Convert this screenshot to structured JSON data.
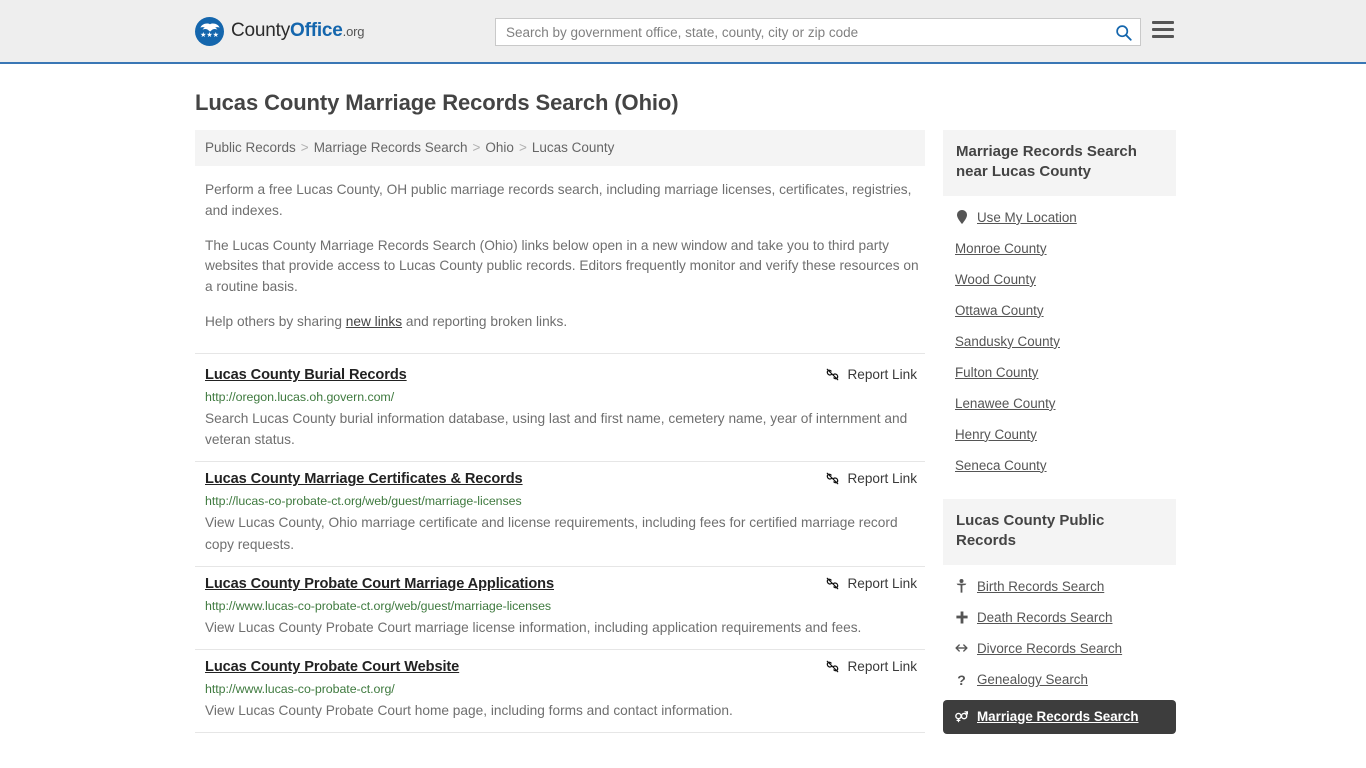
{
  "header": {
    "logo_text_1": "County",
    "logo_text_2": "Office",
    "logo_text_3": ".org",
    "logo_stars": "★★★",
    "search_placeholder": "Search by government office, state, county, city or zip code",
    "search_value": "",
    "search_icon": "search-icon",
    "menu_icon": "hamburger-menu-icon"
  },
  "page": {
    "title": "Lucas County Marriage Records Search (Ohio)"
  },
  "breadcrumb": {
    "items": [
      {
        "label": "Public Records"
      },
      {
        "label": "Marriage Records Search"
      },
      {
        "label": "Ohio"
      },
      {
        "label": "Lucas County"
      }
    ],
    "separator": ">"
  },
  "intro": {
    "p1": "Perform a free Lucas County, OH public marriage records search, including marriage licenses, certificates, registries, and indexes.",
    "p2": "The Lucas County Marriage Records Search (Ohio) links below open in a new window and take you to third party websites that provide access to Lucas County public records. Editors frequently monitor and verify these resources on a routine basis.",
    "p3_before": "Help others by sharing ",
    "p3_link": "new links",
    "p3_after": " and reporting broken links."
  },
  "results": {
    "report_label": "Report Link",
    "items": [
      {
        "title": "Lucas County Burial Records",
        "url": "http://oregon.lucas.oh.govern.com/",
        "description": "Search Lucas County burial information database, using last and first name, cemetery name, year of internment and veteran status.",
        "report_label": "Report Link"
      },
      {
        "title": "Lucas County Marriage Certificates & Records",
        "url": "http://lucas-co-probate-ct.org/web/guest/marriage-licenses",
        "description": "View Lucas County, Ohio marriage certificate and license requirements, including fees for certified marriage record copy requests.",
        "report_label": "Report Link"
      },
      {
        "title": "Lucas County Probate Court Marriage Applications",
        "url": "http://www.lucas-co-probate-ct.org/web/guest/marriage-licenses",
        "description": "View Lucas County Probate Court marriage license information, including application requirements and fees.",
        "report_label": "Report Link"
      },
      {
        "title": "Lucas County Probate Court Website",
        "url": "http://www.lucas-co-probate-ct.org/",
        "description": "View Lucas County Probate Court home page, including forms and contact information.",
        "report_label": "Report Link"
      }
    ]
  },
  "sidebar": {
    "widget_nearby": {
      "heading": "Marriage Records Search near Lucas County",
      "items": [
        {
          "label": "Use My Location",
          "icon": "map-pin-icon",
          "glyph": "•"
        },
        {
          "label": "Monroe County",
          "icon": "",
          "glyph": ""
        },
        {
          "label": "Wood County",
          "icon": "",
          "glyph": ""
        },
        {
          "label": "Ottawa County",
          "icon": "",
          "glyph": ""
        },
        {
          "label": "Sandusky County",
          "icon": "",
          "glyph": ""
        },
        {
          "label": "Fulton County",
          "icon": "",
          "glyph": ""
        },
        {
          "label": "Lenawee County",
          "icon": "",
          "glyph": ""
        },
        {
          "label": "Henry County",
          "icon": "",
          "glyph": ""
        },
        {
          "label": "Seneca County",
          "icon": "",
          "glyph": ""
        }
      ]
    },
    "widget_public_records": {
      "heading": "Lucas County Public Records",
      "items": [
        {
          "label": "Birth Records Search",
          "icon": "baby-icon",
          "glyph": "♀",
          "highlight": false
        },
        {
          "label": "Death Records Search",
          "icon": "cross-icon",
          "glyph": "✚",
          "highlight": false
        },
        {
          "label": "Divorce Records Search",
          "icon": "left-right-arrow-icon",
          "glyph": "↔",
          "highlight": false
        },
        {
          "label": "Genealogy Search",
          "icon": "question-mark-icon",
          "glyph": "?",
          "highlight": false
        },
        {
          "label": "Marriage Records Search",
          "icon": "male-female-icon",
          "glyph": "⚤",
          "highlight": true
        }
      ]
    }
  },
  "colors": {
    "brand_blue": "#1466ad",
    "header_bg": "#eeeeee",
    "header_border": "#3a77b5",
    "url_green": "#3f7a3f",
    "panel_bg": "#f4f4f4",
    "highlight_bg": "#3d3d3d"
  }
}
